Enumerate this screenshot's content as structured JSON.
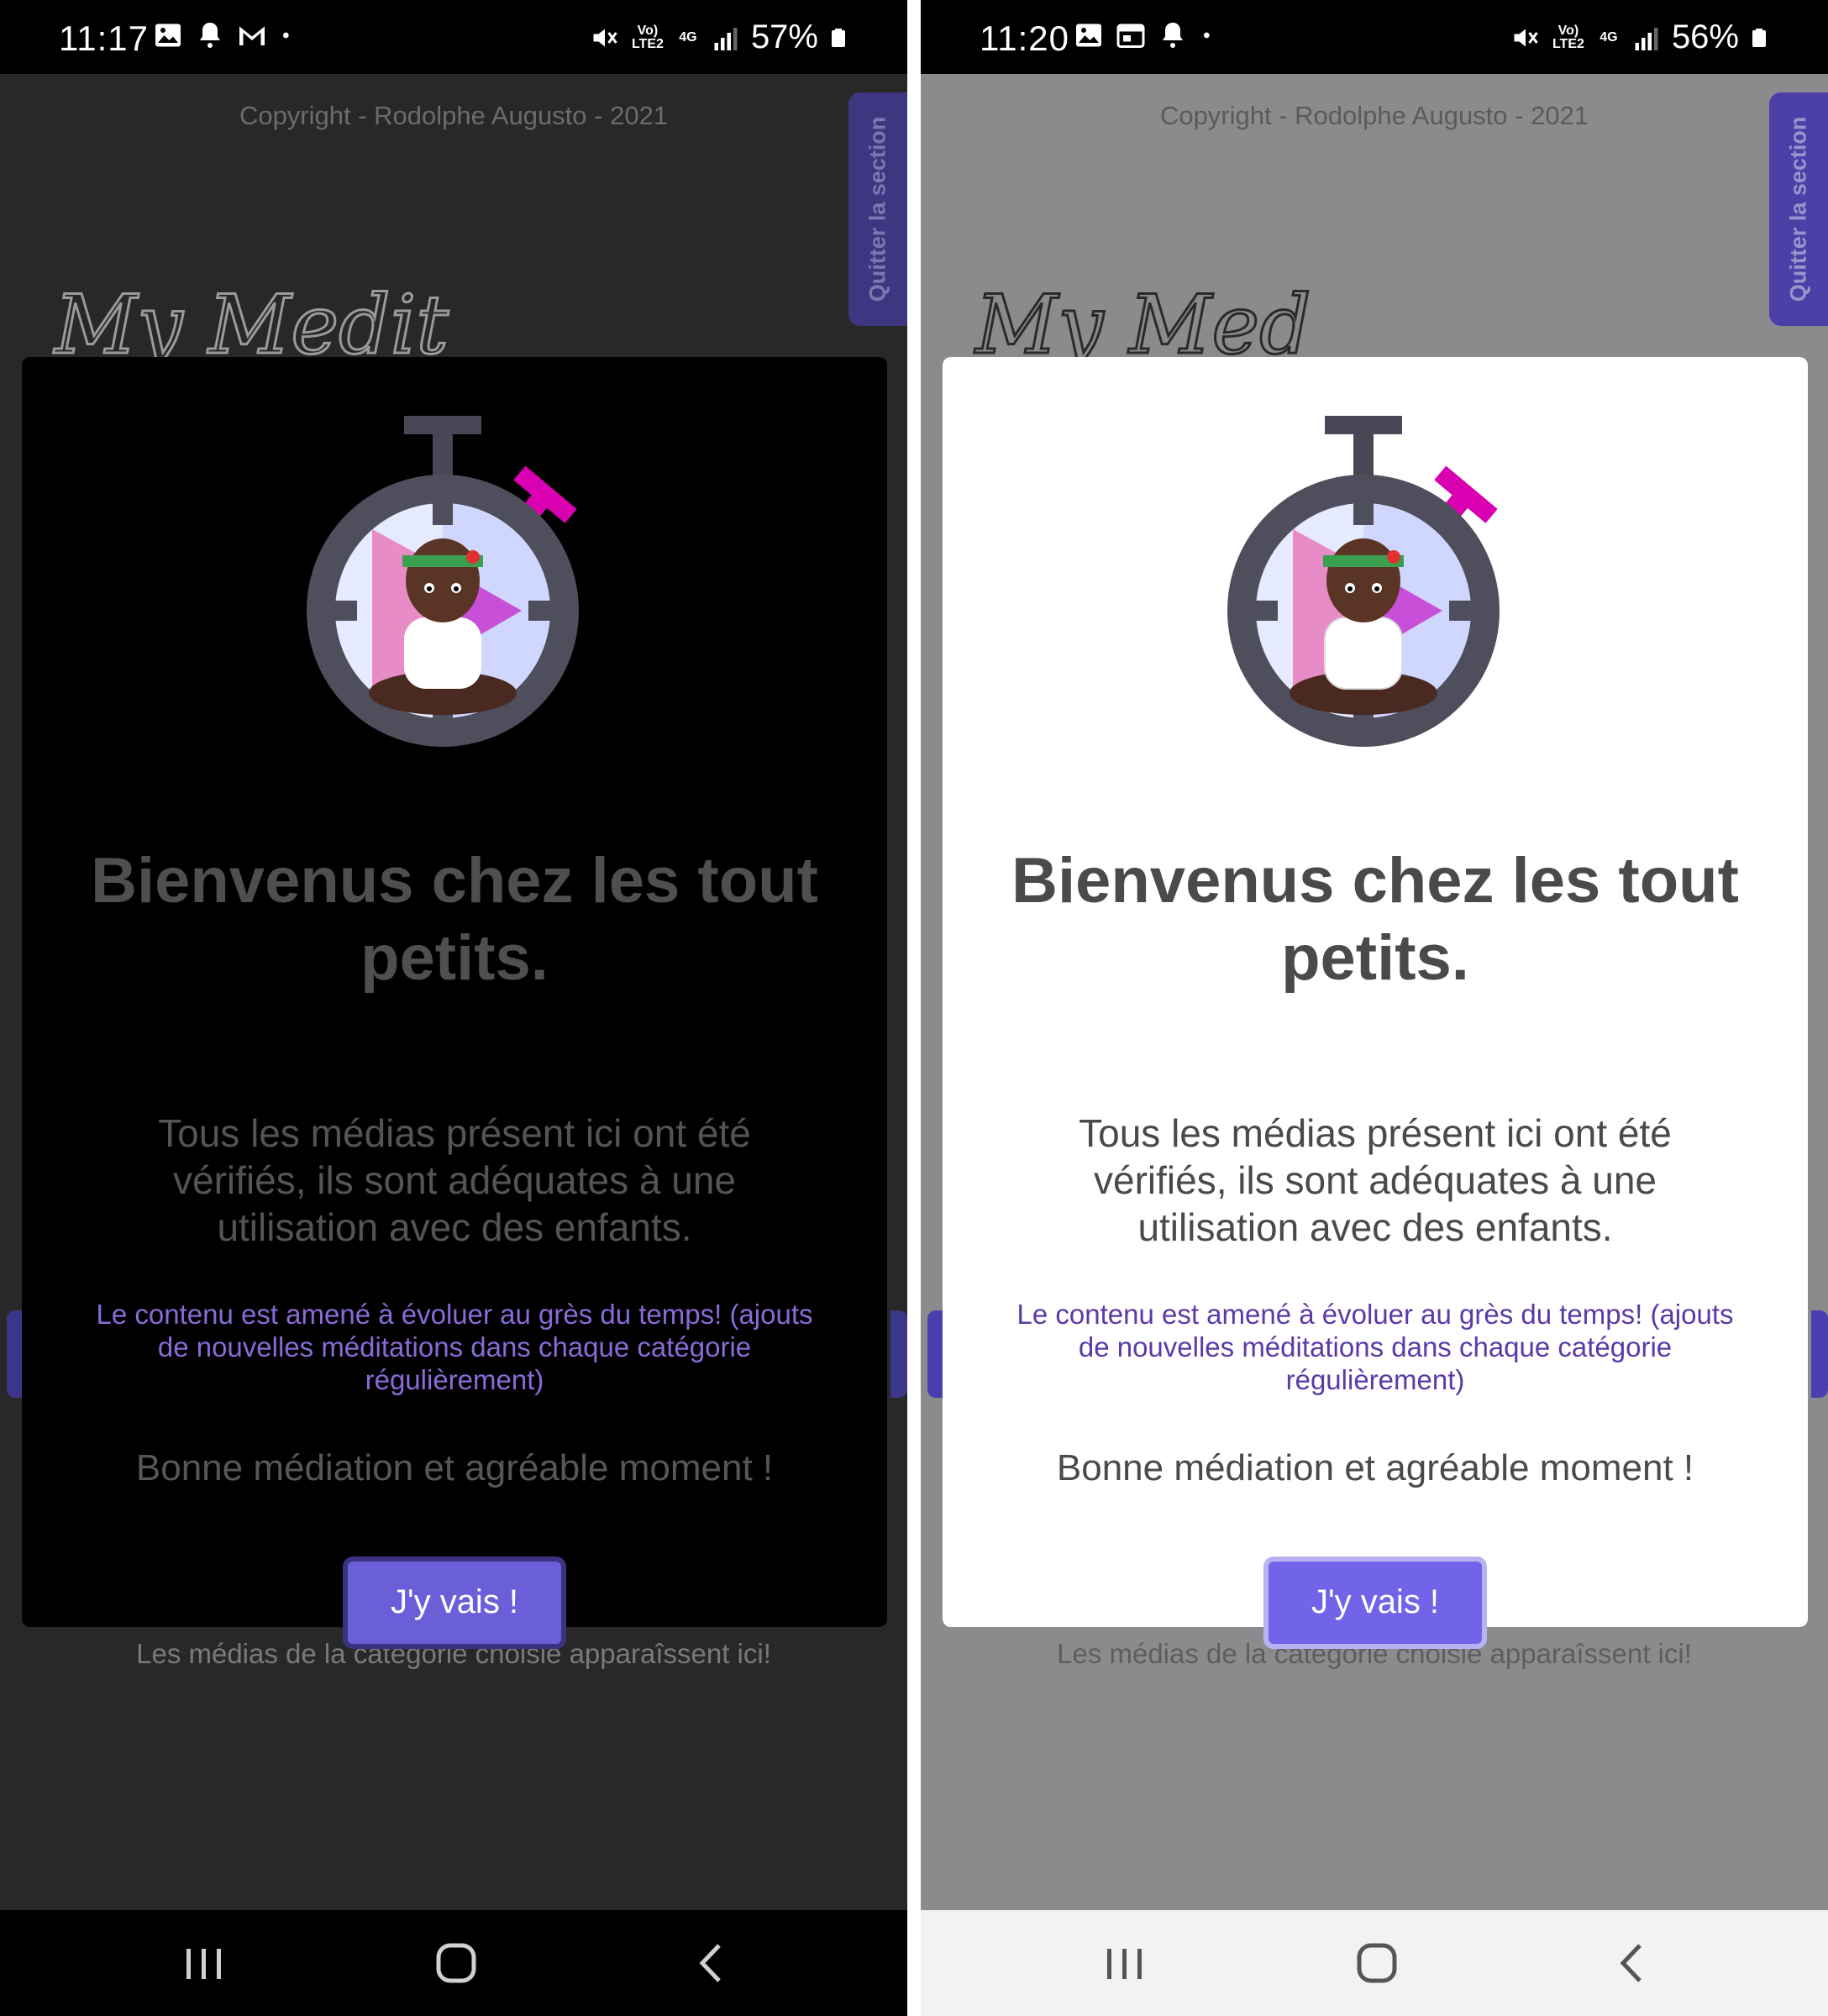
{
  "screens": [
    {
      "theme": "dark",
      "status": {
        "time": "11:17",
        "battery": "57%",
        "network": "4G",
        "carrier_label": "Vo) LTE2"
      },
      "copyright": "Copyright - Rodolphe Augusto - 2021",
      "exit_tab": "Quitter la section",
      "logo_text": "My Medit",
      "modal": {
        "title": "Bienvenus chez les tout petits.",
        "description": "Tous les médias présent ici ont été vérifiés, ils sont adéquates à une utilisation avec des enfants.",
        "note": "Le contenu est amené à évoluer au grès du temps! (ajouts de nouvelles méditations dans chaque catégorie régulièrement)",
        "wish": "Bonne médiation et agréable moment !",
        "button": "J'y vais !"
      },
      "bottom_message": "Les médias de la catégorie choisie apparaîssent ici!"
    },
    {
      "theme": "light",
      "status": {
        "time": "11:20",
        "battery": "56%",
        "network": "4G",
        "carrier_label": "Vo) LTE2"
      },
      "copyright": "Copyright - Rodolphe Augusto - 2021",
      "exit_tab": "Quitter la section",
      "logo_text": "My Med",
      "modal": {
        "title": "Bienvenus chez les tout petits.",
        "description": "Tous les médias présent ici ont été vérifiés, ils sont adéquates à une utilisation avec des enfants.",
        "note": "Le contenu est amené à évoluer au grès du temps! (ajouts de nouvelles méditations dans chaque catégorie régulièrement)",
        "wish": "Bonne médiation et agréable moment !",
        "button": "J'y vais !"
      },
      "bottom_message": "Les médias de la catégorie choisie apparaîssent ici!"
    }
  ],
  "icons": {
    "status_left": [
      "gallery-icon",
      "notification-bell-icon",
      "gmail-icon",
      "dot-icon"
    ],
    "status_right": [
      "mute-icon",
      "volte-icon",
      "network-4g-icon",
      "signal-icon",
      "battery-icon"
    ],
    "navbar": [
      "recent-apps-icon",
      "home-icon",
      "back-icon"
    ]
  },
  "colors": {
    "accent": "#7264e8",
    "accent_dark": "#6a5fd8",
    "note_purple_dark": "#8a6ad8",
    "note_purple_light": "#5b3aa8",
    "stopwatch_gray": "#4a4a58",
    "stopwatch_pink": "#d800b0"
  }
}
